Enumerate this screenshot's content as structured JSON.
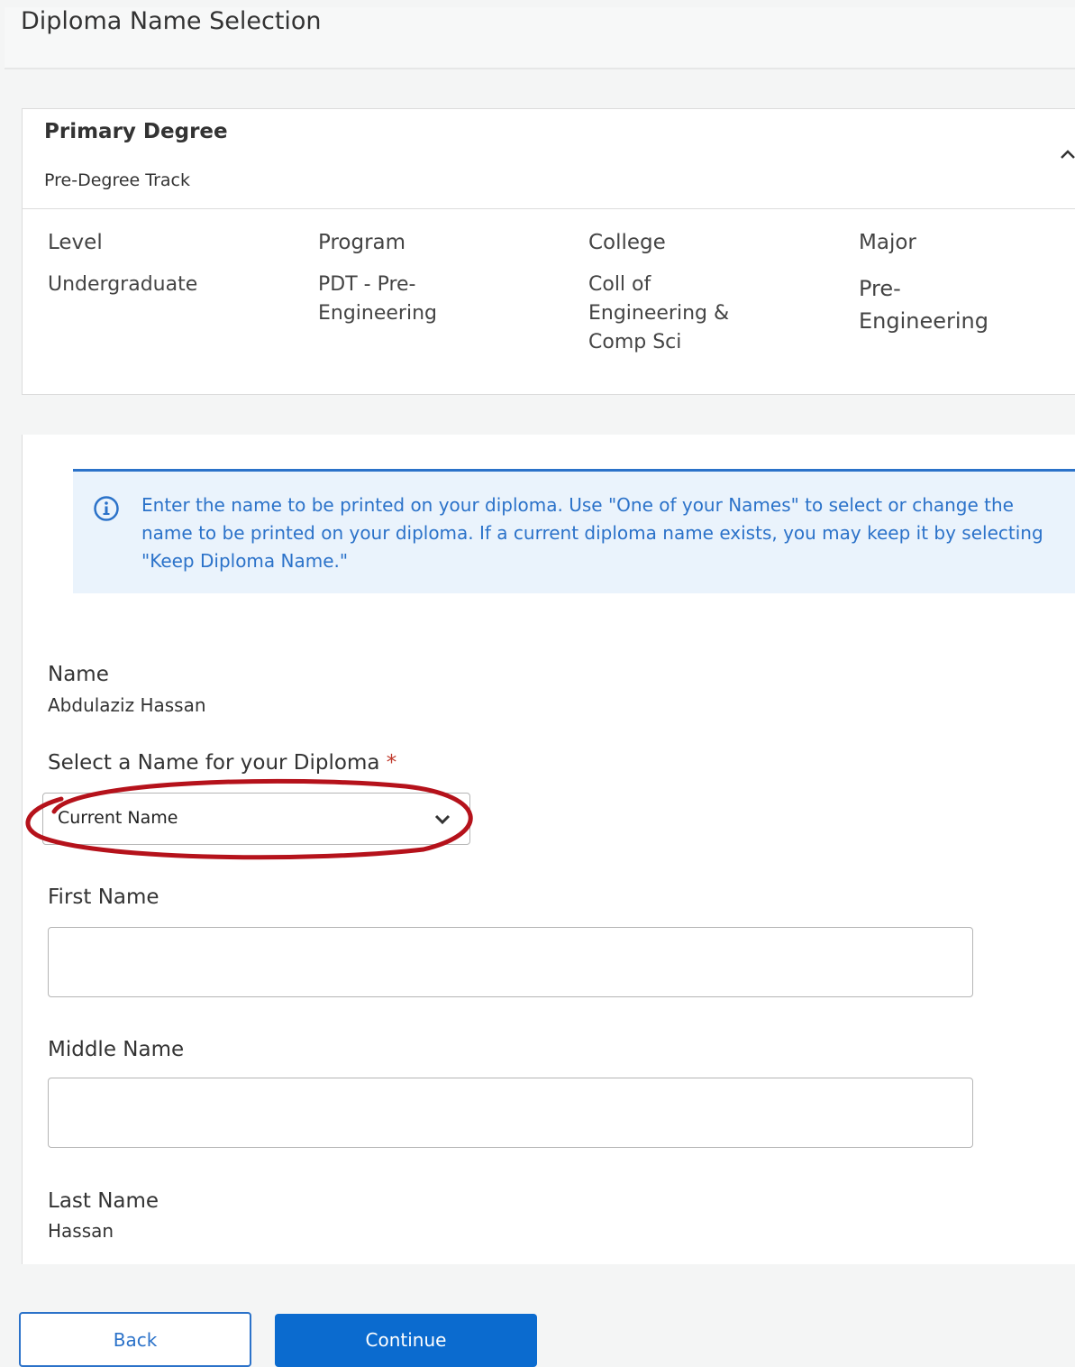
{
  "header": {
    "title": "Diploma Name Selection"
  },
  "degree": {
    "title": "Primary Degree",
    "subtitle": "Pre-Degree Track",
    "columns": [
      {
        "label": "Level",
        "value_lines": [
          "Undergraduate"
        ]
      },
      {
        "label": "Program",
        "value_lines": [
          "PDT - Pre-",
          "Engineering"
        ]
      },
      {
        "label": "College",
        "value_lines": [
          "Coll of",
          "Engineering &",
          "Comp Sci"
        ]
      },
      {
        "label": "Major",
        "value_lines": [
          "Pre-",
          "Engineering"
        ]
      }
    ]
  },
  "info": {
    "text": "Enter the name to be printed on your diploma. Use \"One of your Names\" to select or change the name to be printed on your diploma. If a current diploma name exists, you may keep it by selecting \"Keep Diploma Name.\""
  },
  "form": {
    "name_label": "Name",
    "name_value": "Abdulaziz Hassan",
    "select_label": "Select a Name for your Diploma",
    "required_mark": "*",
    "select_value": "Current Name",
    "first_name_label": "First Name",
    "first_name_value": "",
    "middle_name_label": "Middle Name",
    "middle_name_value": "",
    "last_name_label": "Last Name",
    "last_name_value": "Hassan"
  },
  "buttons": {
    "back": "Back",
    "continue": "Continue"
  },
  "colors": {
    "accent": "#2b72c9",
    "primary_button": "#0b6bcf",
    "required": "#c0392b",
    "annotation": "#b5121b",
    "info_bg": "#eaf3fc"
  }
}
